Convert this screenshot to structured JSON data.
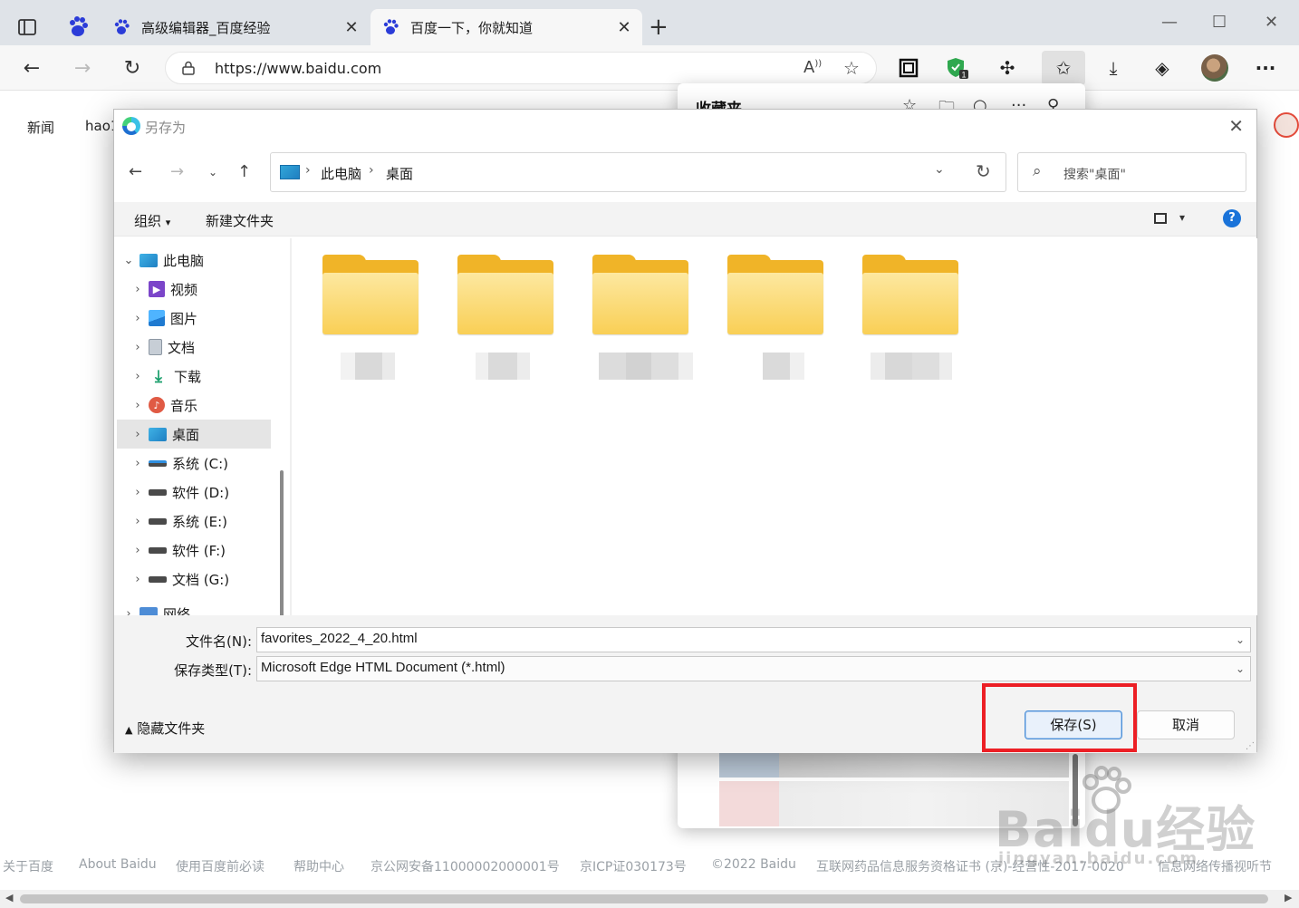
{
  "browser": {
    "tabs": [
      {
        "title": "高级编辑器_百度经验",
        "active": false
      },
      {
        "title": "百度一下，你就知道",
        "active": true
      }
    ],
    "url": "https://www.baidu.com",
    "extension_badge": "1"
  },
  "page": {
    "top_links": [
      "新闻",
      "hao1"
    ],
    "footer_links": [
      "关于百度",
      "About Baidu",
      "使用百度前必读",
      "帮助中心",
      "京公网安备11000002000001号",
      "京ICP证030173号",
      "©2022 Baidu",
      "互联网药品信息服务资格证书 (京)-经营性-2017-0020",
      "信息网络传播视听节"
    ]
  },
  "favorites_panel": {
    "title": "收藏夹"
  },
  "dialog": {
    "title": "另存为",
    "breadcrumb": [
      "此电脑",
      "桌面"
    ],
    "search_placeholder": "搜索\"桌面\"",
    "commands": {
      "organize": "组织",
      "new_folder": "新建文件夹"
    },
    "help": "?",
    "tree": [
      {
        "label": "此电脑",
        "icon": "pc",
        "expanded": true,
        "level": 0
      },
      {
        "label": "视频",
        "icon": "video",
        "level": 1
      },
      {
        "label": "图片",
        "icon": "pic",
        "level": 1
      },
      {
        "label": "文档",
        "icon": "doc",
        "level": 1
      },
      {
        "label": "下载",
        "icon": "dl",
        "level": 1
      },
      {
        "label": "音乐",
        "icon": "music",
        "level": 1
      },
      {
        "label": "桌面",
        "icon": "desk",
        "level": 1,
        "selected": true
      },
      {
        "label": "系统 (C:)",
        "icon": "sysdrive",
        "level": 1
      },
      {
        "label": "软件 (D:)",
        "icon": "drive",
        "level": 1
      },
      {
        "label": "系统 (E:)",
        "icon": "drive",
        "level": 1
      },
      {
        "label": "软件 (F:)",
        "icon": "drive",
        "level": 1
      },
      {
        "label": "文档 (G:)",
        "icon": "drive",
        "level": 1
      },
      {
        "label": "网络",
        "icon": "net",
        "level": 0
      }
    ],
    "folder_count": 5,
    "filename_label": "文件名(N):",
    "filename_value": "favorites_2022_4_20.html",
    "filetype_label": "保存类型(T):",
    "filetype_value": "Microsoft Edge HTML Document (*.html)",
    "hide_folders": "隐藏文件夹",
    "save_button": "保存(S)",
    "cancel_button": "取消"
  },
  "watermark": {
    "brand": "Baidu经验",
    "url": "jingyan.baidu.com"
  },
  "colors": {
    "highlight_box": "#ec1f25",
    "help_blue": "#1a73d9",
    "folder_yellow": "#f9cf55"
  }
}
